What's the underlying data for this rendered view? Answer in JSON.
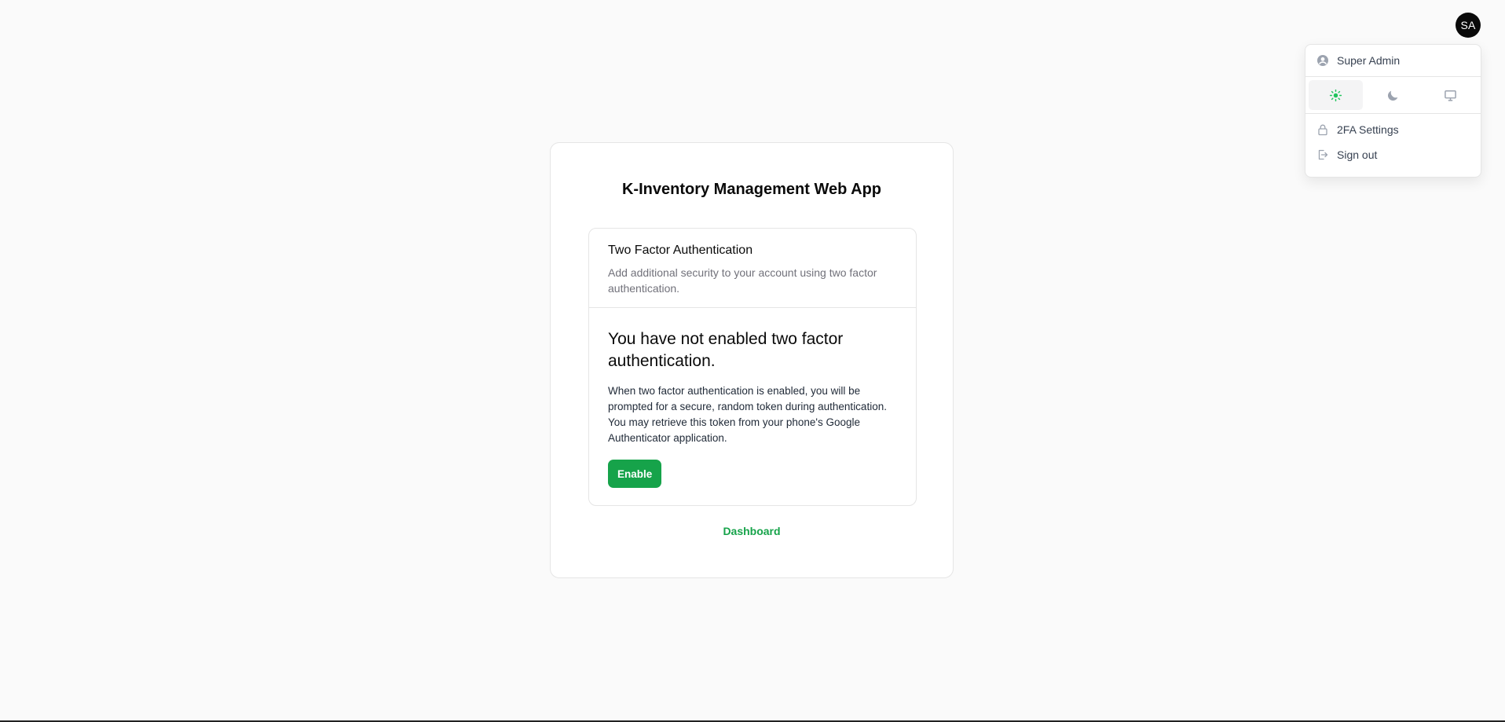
{
  "user": {
    "initials": "SA",
    "name": "Super Admin"
  },
  "menu": {
    "theme_options": [
      {
        "icon": "sun-icon",
        "active": true
      },
      {
        "icon": "moon-icon",
        "active": false
      },
      {
        "icon": "monitor-icon",
        "active": false
      }
    ],
    "twofa_settings": "2FA Settings",
    "sign_out": "Sign out"
  },
  "app": {
    "title": "K-Inventory Management Web App"
  },
  "twofa": {
    "title": "Two Factor Authentication",
    "description": "Add additional security to your account using two factor authentication.",
    "status_heading": "You have not enabled two factor authentication.",
    "body": "When two factor authentication is enabled, you will be prompted for a secure, random token during authentication. You may retrieve this token from your phone's Google Authenticator application.",
    "enable_label": "Enable"
  },
  "footer": {
    "dashboard_link": "Dashboard"
  },
  "colors": {
    "accent": "#16a34a",
    "background": "#fafafa",
    "avatar": "#0a0a0a"
  }
}
